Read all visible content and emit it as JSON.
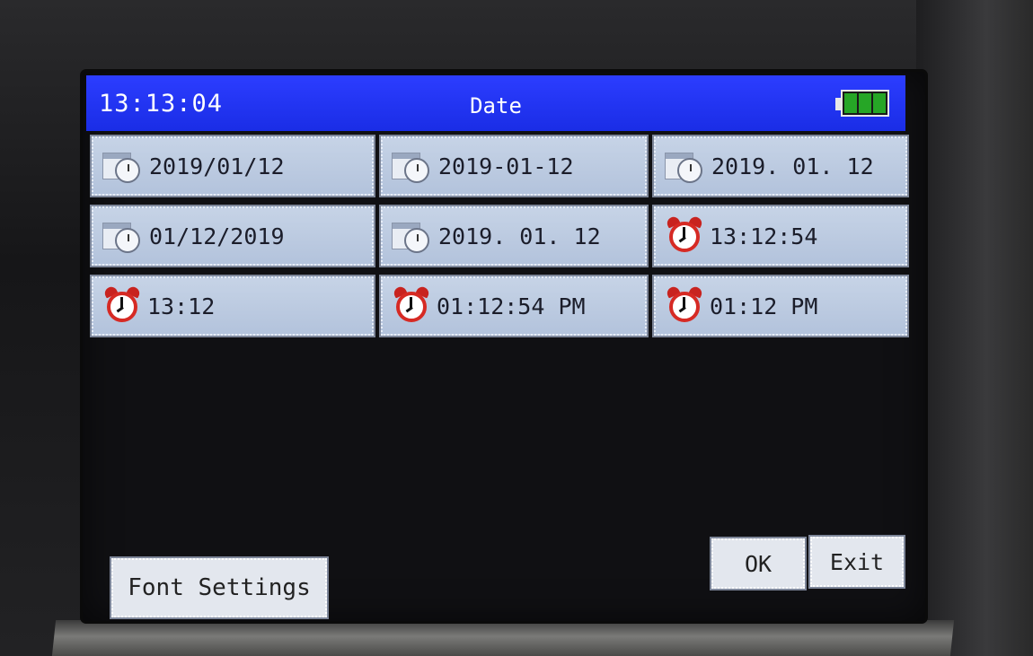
{
  "header": {
    "time": "13:13:04",
    "title": "Date",
    "battery_level": 1.0
  },
  "formats": [
    {
      "label": "2019/01/12",
      "icon": "calendar-clock-icon"
    },
    {
      "label": "2019-01-12",
      "icon": "calendar-clock-icon"
    },
    {
      "label": "2019. 01. 12",
      "icon": "calendar-clock-icon"
    },
    {
      "label": "01/12/2019",
      "icon": "calendar-clock-icon"
    },
    {
      "label": "2019. 01. 12",
      "icon": "calendar-clock-icon"
    },
    {
      "label": "13:12:54",
      "icon": "alarm-clock-icon"
    },
    {
      "label": "13:12",
      "icon": "alarm-clock-icon"
    },
    {
      "label": "01:12:54 PM",
      "icon": "alarm-clock-icon"
    },
    {
      "label": "01:12 PM",
      "icon": "alarm-clock-icon"
    }
  ],
  "buttons": {
    "font_settings": "Font Settings",
    "ok": "OK",
    "exit": "Exit"
  },
  "colors": {
    "titlebar": "#1a2de6",
    "battery": "#26a626",
    "button_face": "#c6d3e6"
  }
}
